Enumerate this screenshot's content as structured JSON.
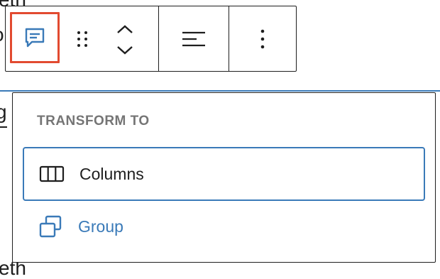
{
  "background_text": {
    "top": "eth",
    "mid1": "o",
    "mid2": "g",
    "bottom": "eth"
  },
  "toolbar": {
    "block_switcher_icon": "speech-bubble-icon",
    "drag_handle_icon": "drag-handle-icon",
    "move_up_icon": "chevron-up-icon",
    "move_down_icon": "chevron-down-icon",
    "align_icon": "align-left-icon",
    "options_icon": "more-vertical-icon",
    "highlight_color": "#e24a30",
    "accent_color": "#3a7ab8"
  },
  "transform_menu": {
    "heading": "TRANSFORM TO",
    "items": [
      {
        "label": "Columns",
        "icon": "columns-icon",
        "focused": true
      },
      {
        "label": "Group",
        "icon": "group-icon",
        "focused": false
      }
    ]
  }
}
